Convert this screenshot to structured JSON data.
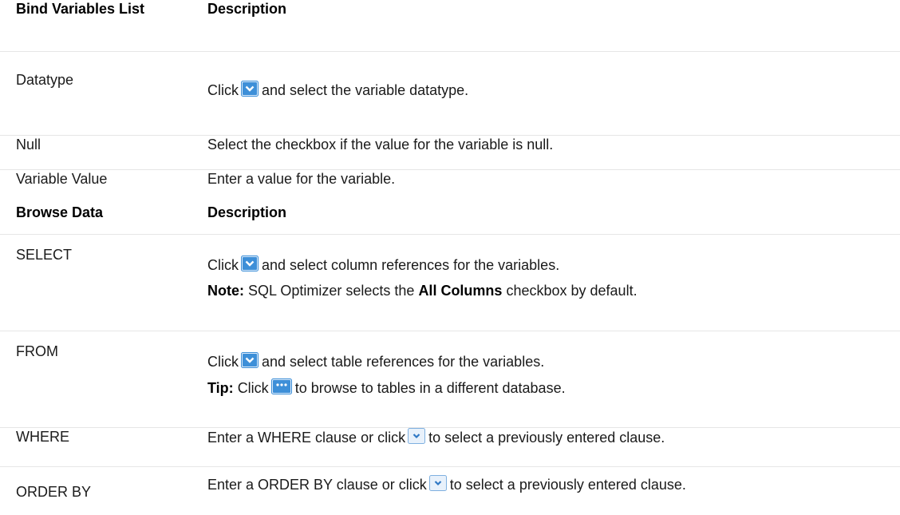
{
  "table1": {
    "header": {
      "col1": "Bind Variables List",
      "col2": "Description"
    },
    "rows": [
      {
        "name": "Datatype",
        "prefix": "Click",
        "suffix": "and select the variable datatype.",
        "icon": "dropdown-arrow-icon"
      },
      {
        "name": "Null",
        "text": "Select the checkbox if the value for the variable is null."
      },
      {
        "name": "Variable Value",
        "text": "Enter a value for the variable."
      }
    ]
  },
  "table2": {
    "header": {
      "col1": "Browse Data",
      "col2": "Description"
    },
    "rows": [
      {
        "name": "SELECT",
        "prefix": "Click",
        "suffix": "and select column references for the variables.",
        "icon": "dropdown-arrow-icon",
        "note_label": "Note:",
        "note_text1": "SQL Optimizer selects the",
        "note_bold": "All Columns",
        "note_text2": "checkbox by default."
      },
      {
        "name": "FROM",
        "prefix": "Click",
        "suffix": "and select table references for the variables.",
        "icon": "dropdown-arrow-icon",
        "tip_label": "Tip:",
        "tip_prefix": "Click",
        "tip_suffix": "to browse to tables in a different database.",
        "tip_icon": "ellipsis-browse-icon"
      },
      {
        "name": "WHERE",
        "prefix": "Enter a WHERE clause or click",
        "suffix": "to select a previously entered clause.",
        "icon": "small-dropdown-icon"
      },
      {
        "name": "ORDER BY",
        "prefix": "Enter a ORDER BY clause or click",
        "suffix": "to select a previously entered clause.",
        "icon": "small-dropdown-icon"
      }
    ]
  },
  "colors": {
    "icon_blue": "#3d8fd8",
    "icon_blue_light": "#dcebfa",
    "separator": "#e6e6e6"
  }
}
